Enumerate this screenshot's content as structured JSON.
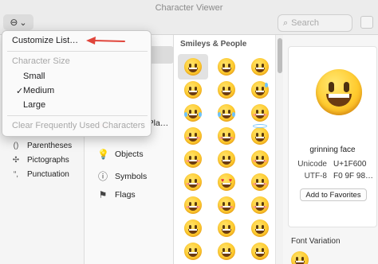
{
  "window": {
    "title": "Character Viewer"
  },
  "toolbar": {
    "action_icon": "ellipsis-circle-icon",
    "chevron": "⌄",
    "search_placeholder": "Search"
  },
  "menu": {
    "customize_list": "Customize List…",
    "character_size_header": "Character Size",
    "small": "Small",
    "medium": "Medium",
    "large": "Large",
    "checked": "Medium",
    "clear_frequent": "Clear Frequently Used Characters"
  },
  "sidebar": {
    "items": [
      {
        "label": "Parentheses",
        "icon": "parentheses-icon",
        "glyph": "()"
      },
      {
        "label": "Pictographs",
        "icon": "pictographs-icon",
        "glyph": "✣"
      },
      {
        "label": "Punctuation",
        "icon": "punctuation-icon",
        "glyph": "“,"
      }
    ]
  },
  "categories": {
    "items": [
      {
        "label": "Travel & Pla…",
        "icon": "car-icon",
        "glyph": "🚗"
      },
      {
        "label": "Objects",
        "icon": "lightbulb-icon",
        "glyph": "💡"
      },
      {
        "label": "Symbols",
        "icon": "symbols-icon",
        "glyph": "ⓘ"
      },
      {
        "label": "Flags",
        "icon": "flag-icon",
        "glyph": "⚑"
      }
    ]
  },
  "grid": {
    "section_title": "Smileys & People"
  },
  "details": {
    "name": "grinning face",
    "unicode_label": "Unicode",
    "unicode_value": "U+1F600",
    "utf8_label": "UTF-8",
    "utf8_value": "F0 9F 98…",
    "add_favorites": "Add to Favorites",
    "font_variation": "Font Variation"
  },
  "colors": {
    "arrow": "#e0443a",
    "emoji_yellow": "#ffcc2f"
  }
}
